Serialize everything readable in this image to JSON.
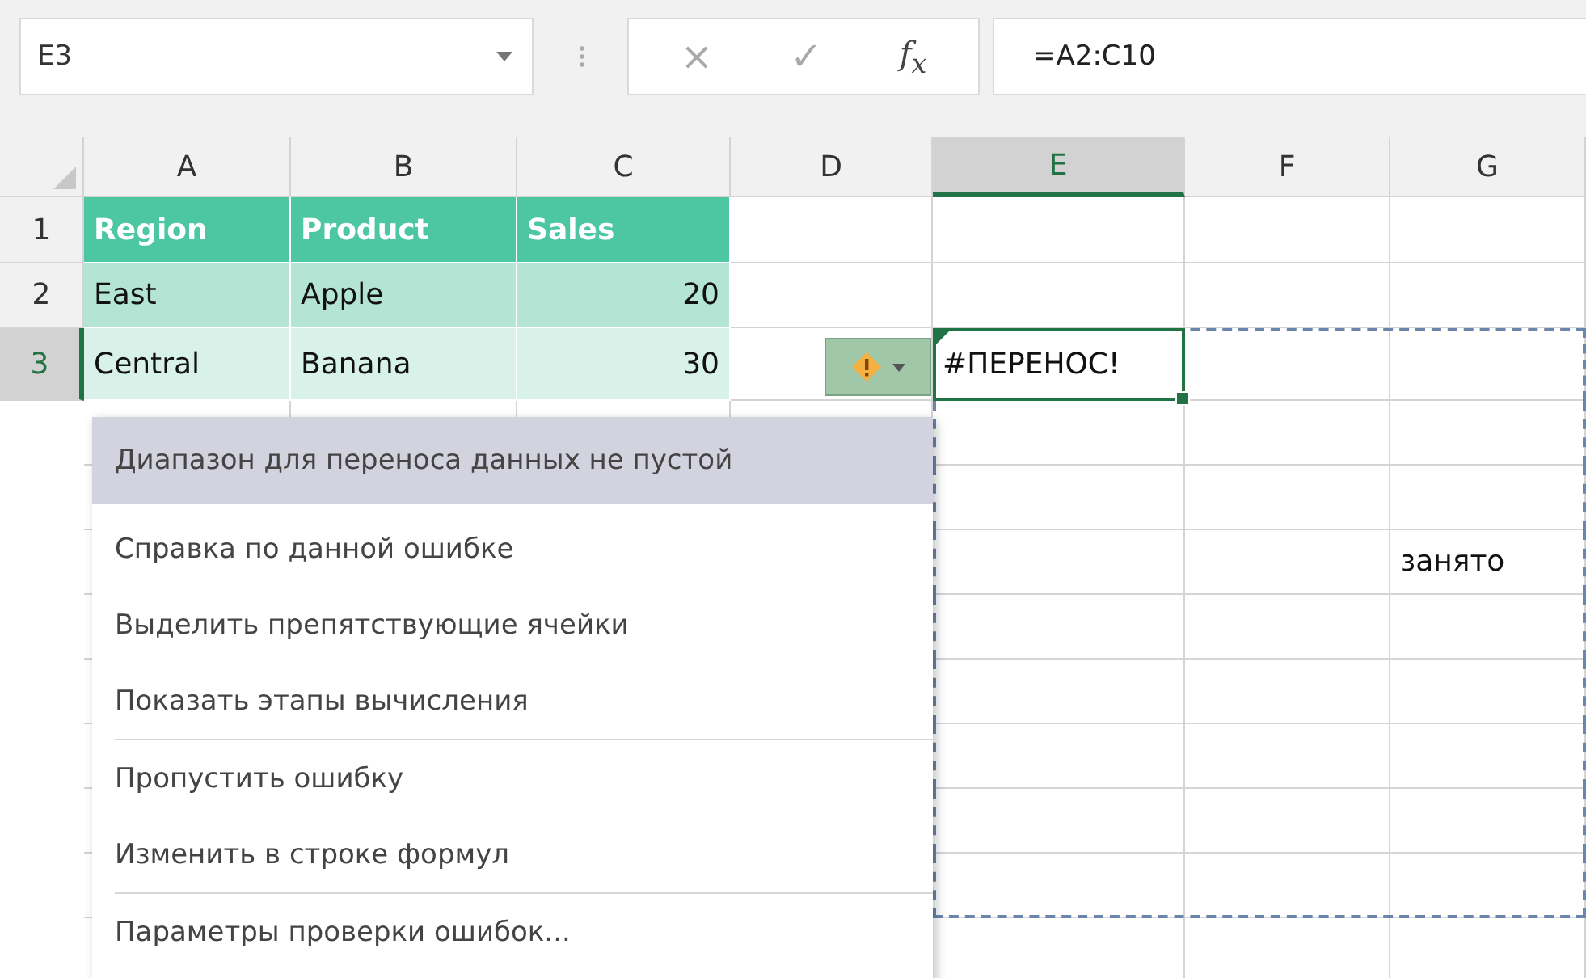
{
  "name_box": {
    "value": "E3"
  },
  "formula_buttons": {
    "cancel": "×",
    "enter": "✓",
    "function": "f$_{x}$"
  },
  "formula": {
    "value": "=A2:C10"
  },
  "columns": [
    {
      "label": "A",
      "selected": false
    },
    {
      "label": "B",
      "selected": false
    },
    {
      "label": "C",
      "selected": false
    },
    {
      "label": "D",
      "selected": false
    },
    {
      "label": "E",
      "selected": true
    },
    {
      "label": "F",
      "selected": false
    },
    {
      "label": "G",
      "selected": false
    }
  ],
  "rows": [
    {
      "header": "1",
      "selected": false,
      "spill": false,
      "cells": [
        {
          "kind": "head",
          "text": "Region"
        },
        {
          "kind": "head",
          "text": "Product"
        },
        {
          "kind": "head",
          "text": "Sales"
        },
        {
          "kind": "plain"
        },
        {
          "kind": "plain"
        },
        {
          "kind": "plain"
        },
        {
          "kind": "plain"
        }
      ]
    },
    {
      "header": "2",
      "selected": false,
      "spill": false,
      "cells": [
        {
          "kind": "band-dark",
          "text": "East"
        },
        {
          "kind": "band-dark",
          "text": "Apple"
        },
        {
          "kind": "band-dark",
          "text": "20",
          "numeric": true
        },
        {
          "kind": "plain"
        },
        {
          "kind": "plain"
        },
        {
          "kind": "plain"
        },
        {
          "kind": "plain"
        }
      ]
    },
    {
      "header": "3",
      "selected": true,
      "spill": true,
      "cells": [
        {
          "kind": "band-light",
          "text": "Central"
        },
        {
          "kind": "band-light",
          "text": "Banana"
        },
        {
          "kind": "band-light",
          "text": "30",
          "numeric": true
        },
        {
          "kind": "plain",
          "error_tag": true
        },
        {
          "kind": "plain",
          "text": "#ПЕРЕНОС!",
          "error": true
        },
        {
          "kind": "plain"
        },
        {
          "kind": "plain"
        }
      ]
    },
    {
      "spill": true,
      "cells": [
        {
          "kind": "plain"
        },
        {
          "kind": "plain"
        },
        {
          "kind": "plain"
        },
        {
          "kind": "plain"
        },
        {
          "kind": "plain"
        },
        {
          "kind": "plain"
        },
        {
          "kind": "plain"
        }
      ]
    },
    {
      "spill": true,
      "cells": [
        {
          "kind": "plain"
        },
        {
          "kind": "plain"
        },
        {
          "kind": "plain"
        },
        {
          "kind": "plain"
        },
        {
          "kind": "plain"
        },
        {
          "kind": "plain"
        },
        {
          "kind": "plain"
        }
      ]
    },
    {
      "spill": true,
      "cells": [
        {
          "kind": "plain"
        },
        {
          "kind": "plain"
        },
        {
          "kind": "plain"
        },
        {
          "kind": "plain"
        },
        {
          "kind": "plain"
        },
        {
          "kind": "plain"
        },
        {
          "kind": "plain",
          "text": "занято"
        }
      ]
    },
    {
      "spill": true,
      "cells": [
        {
          "kind": "plain"
        },
        {
          "kind": "plain"
        },
        {
          "kind": "plain"
        },
        {
          "kind": "plain"
        },
        {
          "kind": "plain"
        },
        {
          "kind": "plain"
        },
        {
          "kind": "plain"
        }
      ]
    },
    {
      "spill": true,
      "cells": [
        {
          "kind": "plain"
        },
        {
          "kind": "plain"
        },
        {
          "kind": "plain"
        },
        {
          "kind": "plain"
        },
        {
          "kind": "plain"
        },
        {
          "kind": "plain"
        },
        {
          "kind": "plain"
        }
      ]
    },
    {
      "spill": true,
      "cells": [
        {
          "kind": "plain"
        },
        {
          "kind": "plain"
        },
        {
          "kind": "plain"
        },
        {
          "kind": "plain"
        },
        {
          "kind": "plain"
        },
        {
          "kind": "plain"
        },
        {
          "kind": "plain"
        }
      ]
    },
    {
      "spill": true,
      "cells": [
        {
          "kind": "plain"
        },
        {
          "kind": "plain"
        },
        {
          "kind": "plain"
        },
        {
          "kind": "plain"
        },
        {
          "kind": "plain"
        },
        {
          "kind": "plain"
        },
        {
          "kind": "plain"
        }
      ]
    },
    {
      "spill": true,
      "cells": [
        {
          "kind": "plain"
        },
        {
          "kind": "plain"
        },
        {
          "kind": "plain"
        },
        {
          "kind": "plain"
        },
        {
          "kind": "plain"
        },
        {
          "kind": "plain"
        },
        {
          "kind": "plain"
        }
      ]
    },
    {
      "spill": false,
      "cells": [
        {
          "kind": "plain"
        },
        {
          "kind": "plain"
        },
        {
          "kind": "plain"
        },
        {
          "kind": "plain"
        },
        {
          "kind": "plain"
        },
        {
          "kind": "plain"
        },
        {
          "kind": "plain"
        }
      ]
    }
  ],
  "error_menu": {
    "open": true,
    "items": [
      {
        "kind": "title",
        "text": "Диапазон для переноса данных не пустой",
        "separator_before": false
      },
      {
        "kind": "item",
        "text": "Справка по данной ошибке",
        "separator_before": false
      },
      {
        "kind": "item",
        "text": "Выделить препятствующие ячейки",
        "separator_before": false
      },
      {
        "kind": "item",
        "text": "Показать этапы вычисления",
        "separator_before": false
      },
      {
        "kind": "item",
        "text": "Пропустить ошибку",
        "separator_before": true
      },
      {
        "kind": "item",
        "text": "Изменить в строке формул",
        "separator_before": false
      },
      {
        "kind": "item",
        "text": "Параметры проверки ошибок...",
        "separator_before": true
      }
    ]
  }
}
